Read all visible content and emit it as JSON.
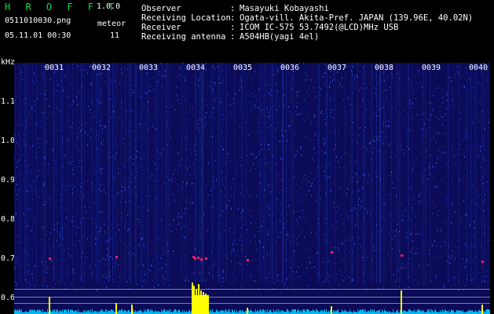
{
  "app": {
    "title": "H R O F F T",
    "version": "1.0.0"
  },
  "file": {
    "name": "0511010030.png",
    "datetime": "05.11.01 00:30"
  },
  "meteor": {
    "label": "meteor",
    "count": "11"
  },
  "info": [
    {
      "label": "Observer",
      "value": "Masayuki Kobayashi"
    },
    {
      "label": "Receiving Location",
      "value": "Ogata-vill. Akita-Pref. JAPAN (139.96E, 40.02N)"
    },
    {
      "label": "Receiver",
      "value": "ICOM IC-575 53.7492(@LCD)MHz USB"
    },
    {
      "label": "Receiving antenna",
      "value": "A504HB(yagi 4el)"
    }
  ],
  "axis": {
    "unit": "kHz",
    "y_ticks": [
      "1.1",
      "1.0",
      "0.9",
      "0.8",
      "0.7",
      "0.6"
    ],
    "x_ticks": [
      "0031",
      "0032",
      "0033",
      "0034",
      "0035",
      "0036",
      "0037",
      "0038",
      "0039",
      "0040"
    ]
  },
  "colors": {
    "background": "#000000",
    "spectrogram": "#0b0b58",
    "noise": "#3a5cff",
    "echo": "#ff2060",
    "power": "#ffff00",
    "baseline": "#00c8ff",
    "title": "#00e040"
  }
}
